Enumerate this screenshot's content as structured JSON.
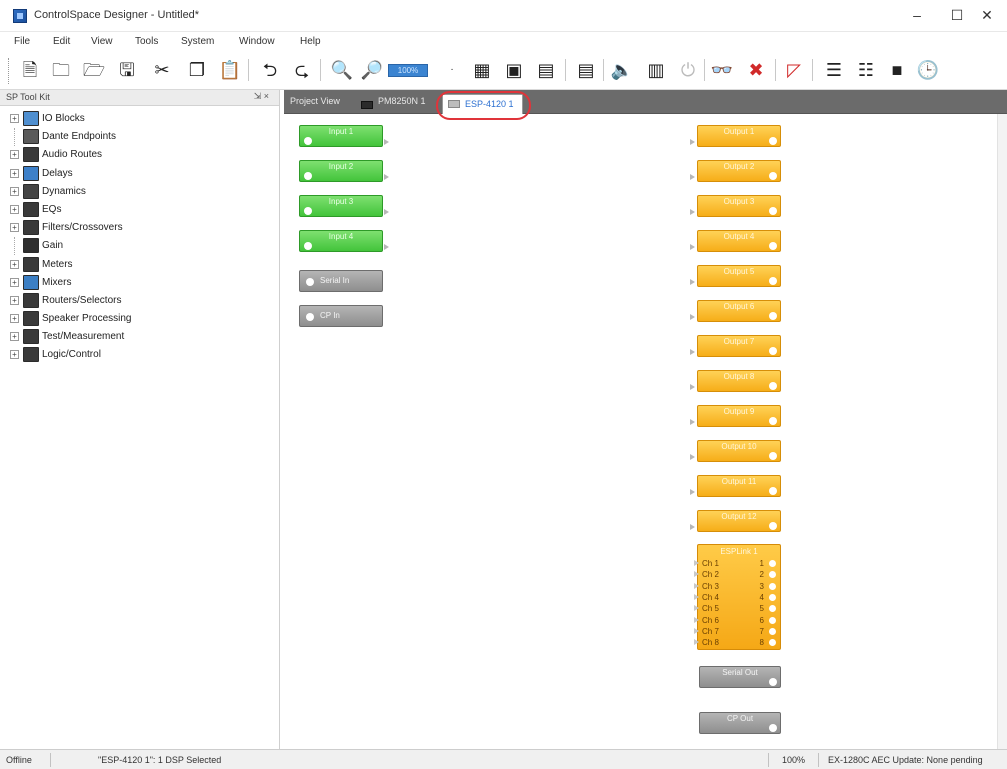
{
  "window": {
    "title": "ControlSpace Designer - Untitled*",
    "minimize": "–",
    "maximize": "☐",
    "close": "✕"
  },
  "menu": [
    "File",
    "Edit",
    "View",
    "Tools",
    "System",
    "Window",
    "Help"
  ],
  "toolbar": {
    "zoom_value": "100%",
    "icons": [
      "new-document-icon",
      "open-folder-icon",
      "open-project-icon",
      "save-icon",
      "cut-icon",
      "copy-icon",
      "paste-icon",
      "undo-icon",
      "redo-icon",
      "zoom-in-icon",
      "zoom-out-icon",
      "zoom-level-icon",
      "grid-icon",
      "layout-icon",
      "window-icon",
      "properties-icon",
      "speaker-icon",
      "device-icon",
      "power-icon",
      "find-icon",
      "connect-icon",
      "network-icon",
      "list-icon",
      "tree-icon",
      "book-icon",
      "clock-icon"
    ]
  },
  "toolkit": {
    "title": "SP Tool Kit",
    "pin": "⇲ ×",
    "items": [
      {
        "label": "IO Blocks",
        "icon": "io-blocks-icon",
        "color": "#4f8fd0",
        "expandable": true
      },
      {
        "label": "Dante Endpoints",
        "icon": "dante-icon",
        "color": "#5a5a5a",
        "expandable": false
      },
      {
        "label": "Audio Routes",
        "icon": "audio-routes-icon",
        "color": "#3a3a3a",
        "expandable": true
      },
      {
        "label": "Delays",
        "icon": "delays-icon",
        "color": "#3d80c9",
        "expandable": true
      },
      {
        "label": "Dynamics",
        "icon": "dynamics-icon",
        "color": "#444444",
        "expandable": true
      },
      {
        "label": "EQs",
        "icon": "eqs-icon",
        "color": "#3a3a3a",
        "expandable": true
      },
      {
        "label": "Filters/Crossovers",
        "icon": "filters-icon",
        "color": "#3a3a3a",
        "expandable": true
      },
      {
        "label": "Gain",
        "icon": "gain-icon",
        "color": "#2f2f2f",
        "expandable": false
      },
      {
        "label": "Meters",
        "icon": "meters-icon",
        "color": "#3a3a3a",
        "expandable": true
      },
      {
        "label": "Mixers",
        "icon": "mixers-icon",
        "color": "#3c7fc4",
        "expandable": true
      },
      {
        "label": "Routers/Selectors",
        "icon": "routers-icon",
        "color": "#3a3a3a",
        "expandable": true
      },
      {
        "label": "Speaker Processing",
        "icon": "speaker-processing-icon",
        "color": "#3a3a3a",
        "expandable": true
      },
      {
        "label": "Test/Measurement",
        "icon": "test-measurement-icon",
        "color": "#3a3a3a",
        "expandable": true
      },
      {
        "label": "Logic/Control",
        "icon": "logic-control-icon",
        "color": "#3a3a3a",
        "expandable": true
      }
    ]
  },
  "tabs": [
    {
      "label": "Project View",
      "active": false
    },
    {
      "label": "PM8250N 1",
      "active": false
    },
    {
      "label": "ESP-4120 1",
      "active": true
    }
  ],
  "inputs": [
    "Input 1",
    "Input 2",
    "Input 3",
    "Input 4"
  ],
  "input_gray": [
    "Serial In",
    "CP In"
  ],
  "outputs": [
    "Output 1",
    "Output 2",
    "Output 3",
    "Output 4",
    "Output 5",
    "Output 6",
    "Output 7",
    "Output 8",
    "Output 9",
    "Output 10",
    "Output 11",
    "Output 12"
  ],
  "esplink": {
    "title": "ESPLink 1",
    "channels": [
      {
        "name": "Ch 1",
        "num": "1"
      },
      {
        "name": "Ch 2",
        "num": "2"
      },
      {
        "name": "Ch 3",
        "num": "3"
      },
      {
        "name": "Ch 4",
        "num": "4"
      },
      {
        "name": "Ch 5",
        "num": "5"
      },
      {
        "name": "Ch 6",
        "num": "6"
      },
      {
        "name": "Ch 7",
        "num": "7"
      },
      {
        "name": "Ch 8",
        "num": "8"
      }
    ]
  },
  "output_gray": [
    "Serial Out",
    "CP Out"
  ],
  "status": {
    "state": "Offline",
    "selection": "\"ESP-4120 1\": 1 DSP Selected",
    "zoom": "100%",
    "update": "EX-1280C AEC Update: None pending"
  }
}
